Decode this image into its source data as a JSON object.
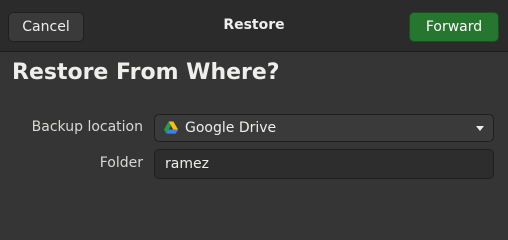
{
  "header": {
    "cancel_label": "Cancel",
    "title": "Restore",
    "forward_label": "Forward"
  },
  "main": {
    "heading": "Restore From Where?",
    "backup_location_label": "Backup location",
    "backup_location_value": "Google Drive",
    "backup_location_icon": "google-drive-icon",
    "folder_label": "Folder",
    "folder_value": "ramez"
  },
  "colors": {
    "background": "#353535",
    "headerbar": "#2b2b2b",
    "forward_button": "#26762f"
  }
}
